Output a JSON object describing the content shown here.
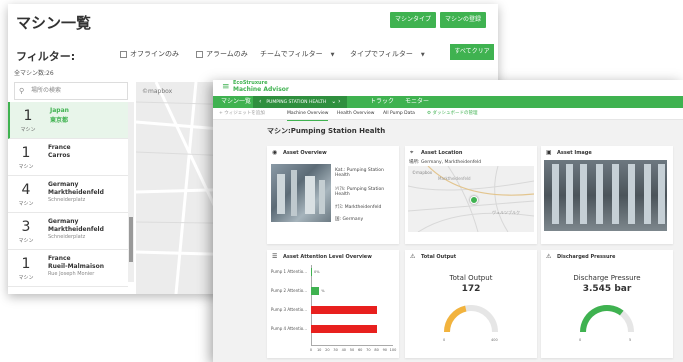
{
  "back_window": {
    "title": "マシン一覧",
    "buttons": {
      "machine_type": "マシンタイプ",
      "register_machine": "マシンの登録"
    },
    "filter_label": "フィルター:",
    "checkboxes": {
      "offline_only": "オフラインのみ",
      "alarm_only": "アラームのみ"
    },
    "selects": {
      "team_filter": "チームでフィルター",
      "type_filter": "タイプでフィルター"
    },
    "clear_all": "すべてクリア",
    "total_count": "全マシン数:26",
    "search_placeholder": "場所の検索",
    "map_logo": "©mapbox",
    "map_place": "中京",
    "list": [
      {
        "count": "1",
        "unit": "マシン",
        "line1": "Japan",
        "line2": "東京都",
        "line3": "",
        "active": true
      },
      {
        "count": "1",
        "unit": "マシン",
        "line1": "France",
        "line2": "Carros",
        "line3": ""
      },
      {
        "count": "4",
        "unit": "マシン",
        "line1": "Germany",
        "line2": "Marktheidenfeld",
        "line3": "Schneiderplatz"
      },
      {
        "count": "3",
        "unit": "マシン",
        "line1": "Germany",
        "line2": "Marktheidenfeld",
        "line3": "Schneiderplatz"
      },
      {
        "count": "1",
        "unit": "マシン",
        "line1": "France",
        "line2": "Rueil-Malmaison",
        "line3": "Rue Joseph Monier"
      }
    ]
  },
  "front_window": {
    "brand_line1": "EcoStruxure",
    "brand_line2": "Machine Advisor",
    "nav": {
      "machine_list": "マシン一覧",
      "current_machine": "PUMPING STATION HEALTH",
      "trace": "トラック",
      "monitor": "モニター"
    },
    "tabs": {
      "add_widget": "+ ウィジェットを追加",
      "machine_overview": "Machine Overview",
      "health_overview": "Health Overview",
      "all_pump_data": "All Pump Data",
      "dashboard_manage": "ダッシュボードの管理"
    },
    "page_heading": "マシン:Pumping Station Health",
    "asset_overview": {
      "title": "Asset Overview",
      "rows": [
        "Kat.: Pumping Station Health",
        "ｼﾘｱﾙ: Pumping Station Health",
        "ｸﾗｽ: Marktheidenfeld",
        "国: Germany"
      ]
    },
    "asset_location": {
      "title": "Asset Location",
      "address": "場所: Germany, Marktheidenfeld",
      "map_logo": "©mapbox",
      "map_label_1": "Marktheidenfeld",
      "map_label_2": "ヴュルツブルク"
    },
    "asset_image": {
      "title": "Asset Image"
    },
    "attention": {
      "title": "Asset Attention Level Overview",
      "pumps": [
        {
          "label": "Pump 1 Attentio...",
          "value": 0,
          "value_text": "0%",
          "color": "#3fb250"
        },
        {
          "label": "Pump 2 Attentio...",
          "value": 10,
          "value_text": "%",
          "color": "#3fb250"
        },
        {
          "label": "Pump 3 Attentio...",
          "value": 80,
          "value_text": "",
          "color": "#e8201e"
        },
        {
          "label": "Pump 4 Attentio...",
          "value": 80,
          "value_text": "",
          "color": "#e8201e"
        }
      ],
      "ticks": [
        "0",
        "10",
        "20",
        "30",
        "40",
        "50",
        "60",
        "70",
        "80",
        "90",
        "100"
      ]
    },
    "total_output": {
      "title": "Total Output",
      "label": "Total Output",
      "value": "172",
      "fill_fraction": 0.43,
      "color": "#f2b33d",
      "min": "0",
      "max": "400"
    },
    "discharged_pressure": {
      "title": "Discharged Pressure",
      "label": "Discharge Pressure",
      "value": "3.545 bar",
      "fill_fraction": 0.71,
      "color": "#3fb250",
      "min": "0",
      "max": "5"
    }
  }
}
